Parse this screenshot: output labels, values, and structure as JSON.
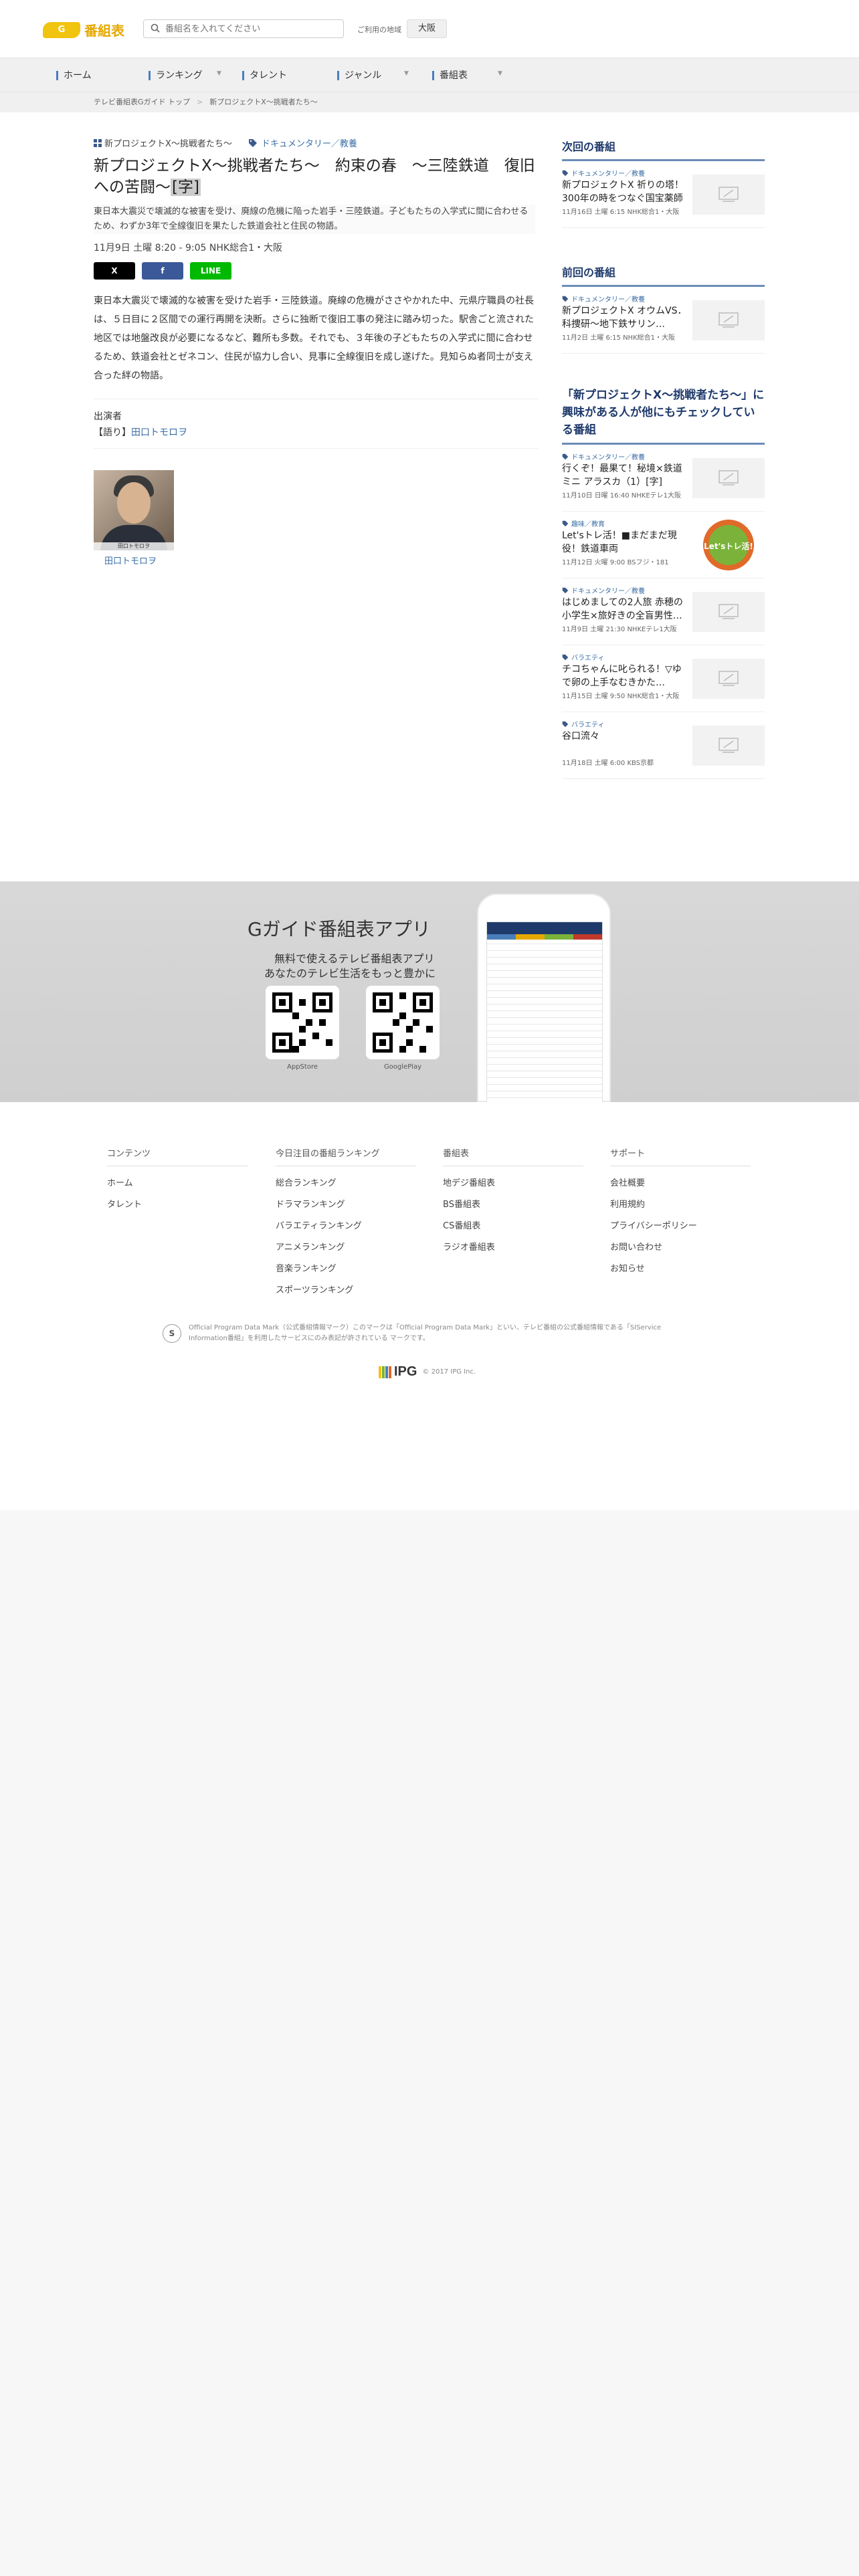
{
  "header": {
    "logo_mark": "G",
    "logo_text": "番組表",
    "search_placeholder": "番組名を入れてください",
    "region_label": "ご利用の地域",
    "region_value": "大阪"
  },
  "nav": {
    "items": [
      {
        "label": "ホーム"
      },
      {
        "label": "ランキング"
      },
      {
        "label": "タレント"
      },
      {
        "label": "ジャンル"
      },
      {
        "label": "番組表"
      }
    ]
  },
  "breadcrumb": {
    "items": [
      "テレビ番組表Gガイド トップ",
      "新プロジェクトX～挑戦者たち～"
    ]
  },
  "program": {
    "series": "新プロジェクトX～挑戦者たち～",
    "genre": "ドキュメンタリー／教養",
    "title_main": "新プロジェクトX～挑戦者たち～　約束の春　～三陸鉄道　復旧への苦闘～",
    "title_badge": "[字]",
    "summary": "東日本大震災で壊滅的な被害を受け、廃線の危機に陥った岩手・三陸鉄道。子どもたちの入学式に間に合わせるため、わずか3年で全線復旧を果たした鉄道会社と住民の物語。",
    "airtime": "11月9日 土曜 8:20 - 9:05 NHK総合1・大阪",
    "share": {
      "x": "X",
      "facebook": "f",
      "line": "LINE"
    },
    "body": "東日本大震災で壊滅的な被害を受けた岩手・三陸鉄道。廃線の危機がささやかれた中、元県庁職員の社長は、５日目に２区間での運行再開を決断。さらに独断で復旧工事の発注に踏み切った。駅舎ごと流された地区では地盤改良が必要になるなど、難所も多数。それでも、３年後の子どもたちの入学式に間に合わせるため、鉄道会社とゼネコン、住民が協力し合い、見事に全線復旧を成し遂げた。見知らぬ者同士が支え合った絆の物語。",
    "cast_heading": "出演者",
    "cast_role": "【語り】",
    "cast_name": "田口トモロヲ",
    "cast_photo_caption": "田口トモロヲ"
  },
  "sidebar": {
    "next": {
      "heading": "次回の番組",
      "items": [
        {
          "genre": "ドキュメンタリー／教養",
          "title": "新プロジェクトX 祈りの塔！300年の時をつなぐ国宝薬師寺…",
          "sub": "11月16日 土曜 6:15 NHK総合1・大阪"
        }
      ]
    },
    "prev": {
      "heading": "前回の番組",
      "items": [
        {
          "genre": "ドキュメンタリー／教養",
          "title": "新プロジェクトX オウムVS．科捜研～地下鉄サリン…",
          "sub": "11月2日 土曜 6:15 NHK総合1・大阪"
        }
      ]
    },
    "related": {
      "heading": "「新プロジェクトX～挑戦者たち～」に興味がある人が他にもチェックしている番組",
      "items": [
        {
          "genre": "ドキュメンタリー／教養",
          "title": "行くぞ！最果て！秘境×鉄道ミニ アラスカ（1）[字]",
          "sub": "11月10日 日曜 16:40 NHKEテレ1大阪"
        },
        {
          "genre": "趣味／教育",
          "title": "Let'sトレ活！■まだまだ現役！鉄道車両",
          "sub": "11月12日 火曜 9:00 BSフジ・181"
        },
        {
          "genre": "ドキュメンタリー／教養",
          "title": "はじめましての2人旅 赤穂の小学生×旅好きの全盲男性…",
          "sub": "11月9日 土曜 21:30 NHKEテレ1大阪"
        },
        {
          "genre": "バラエティ",
          "title": "チコちゃんに叱られる！▽ゆで卵の上手なむきかた…",
          "sub": "11月15日 土曜 9:50 NHK総合1・大阪"
        },
        {
          "genre": "バラエティ",
          "title": "谷口流々",
          "sub": "11月18日 土曜 6:00 KBS京都"
        }
      ]
    },
    "thumb_badge_text": "Let'sトレ活!"
  },
  "banner": {
    "title": "Gガイド番組表アプリ",
    "sub1": "無料で使えるテレビ番組表アプリ",
    "sub2": "あなたのテレビ生活をもっと豊かに",
    "appstore": "AppStore",
    "googleplay": "GooglePlay"
  },
  "footer": {
    "cols": [
      {
        "heading": "コンテンツ",
        "links": [
          "ホーム",
          "タレント"
        ]
      },
      {
        "heading": "今日注目の番組ランキング",
        "links": [
          "総合ランキング",
          "ドラマランキング",
          "バラエティランキング",
          "アニメランキング",
          "音楽ランキング",
          "スポーツランキング"
        ]
      },
      {
        "heading": "番組表",
        "links": [
          "地デジ番組表",
          "BS番組表",
          "CS番組表",
          "ラジオ番組表"
        ]
      },
      {
        "heading": "サポート",
        "links": [
          "会社概要",
          "利用規約",
          "プライバシーポリシー",
          "お問い合わせ",
          "お知らせ"
        ]
      }
    ],
    "note": "Official Program Data Mark（公式番組情報マーク）このマークは「Official Program Data Mark」といい、テレビ番組の公式番組情報である「SIService Information番組」を利用したサービスにのみ表記が許されている マークです。",
    "s_badge": "S",
    "ipg_name": "IPG",
    "copyright": "© 2017 IPG Inc."
  },
  "colors": {
    "accent": "#3a6ea5",
    "heading": "#1e3a6b",
    "logo": "#f1c40f",
    "x": "#000000",
    "facebook": "#3b5998",
    "line": "#00b900"
  }
}
